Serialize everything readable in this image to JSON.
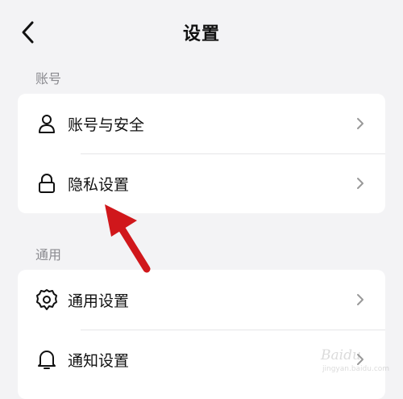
{
  "header": {
    "title": "设置",
    "back_icon": "chevron-left-icon"
  },
  "sections": [
    {
      "label": "账号",
      "items": [
        {
          "label": "账号与安全",
          "icon": "user-icon"
        },
        {
          "label": "隐私设置",
          "icon": "lock-icon"
        }
      ]
    },
    {
      "label": "通用",
      "items": [
        {
          "label": "通用设置",
          "icon": "gear-icon"
        },
        {
          "label": "通知设置",
          "icon": "bell-icon"
        }
      ]
    }
  ],
  "annotation": {
    "arrow_color": "#d0171b"
  },
  "watermark": {
    "text": "Baidu",
    "sub": "jingyan.baidu.com"
  }
}
